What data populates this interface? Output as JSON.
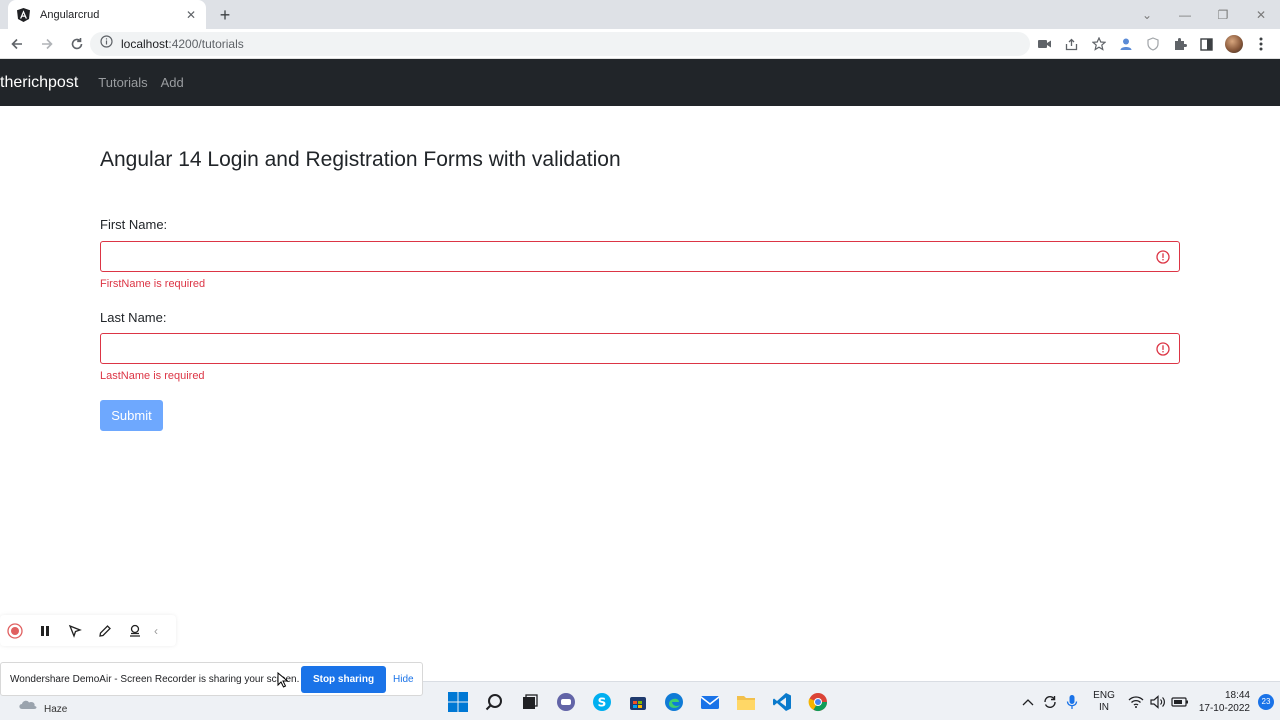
{
  "browser": {
    "tab_title": "Angularcrud",
    "tab_close": "✕",
    "new_tab": "+",
    "url_host": "localhost",
    "url_path": ":4200/tutorials",
    "window_controls": [
      "⌄",
      "—",
      "❐",
      "✕"
    ]
  },
  "navbar": {
    "brand": "therichpost",
    "links": [
      "Tutorials",
      "Add"
    ],
    "background": "#212529"
  },
  "page": {
    "title": "Angular 14 Login and Registration Forms with validation",
    "first_name_label": "First Name:",
    "first_name_value": "",
    "first_name_error": "FirstName is required",
    "last_name_label": "Last Name:",
    "last_name_value": "",
    "last_name_error": "LastName is required",
    "submit_label": "Submit",
    "error_color": "#dc3545",
    "button_color": "#6ea8fe"
  },
  "recorder": {
    "tools": [
      "record-icon",
      "pause-icon",
      "pointer-icon",
      "pen-icon",
      "stamp-icon"
    ],
    "collapse": "‹"
  },
  "share_notice": {
    "text": "Wondershare DemoAir - Screen Recorder is sharing your screen.",
    "stop_label": "Stop sharing",
    "hide_label": "Hide"
  },
  "taskbar": {
    "weather": "Haze",
    "lang_line1": "ENG",
    "lang_line2": "IN",
    "time": "18:44",
    "date": "17-10-2022",
    "notifications": "23"
  }
}
